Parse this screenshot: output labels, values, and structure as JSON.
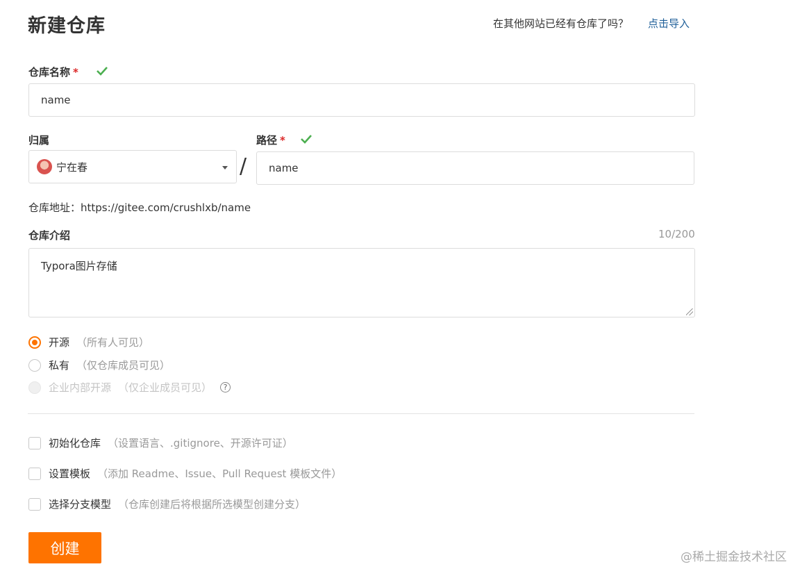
{
  "page_title": "新建仓库",
  "import": {
    "question": "在其他网站已经有仓库了吗？",
    "link": "点击导入"
  },
  "repo_name": {
    "label": "仓库名称",
    "required_mark": "*",
    "value": "name"
  },
  "owner": {
    "label": "归属",
    "selected": "宁在春"
  },
  "path_separator": "/",
  "path": {
    "label": "路径",
    "required_mark": "*",
    "value": "name"
  },
  "repo_address": "仓库地址：https://gitee.com/crushlxb/name",
  "description": {
    "label": "仓库介绍",
    "counter": "10/200",
    "value": "Typora图片存储"
  },
  "visibility": [
    {
      "label": "开源",
      "note": "（所有人可见）",
      "state": "selected"
    },
    {
      "label": "私有",
      "note": "（仅仓库成员可见）",
      "state": "unselected"
    },
    {
      "label": "企业内部开源",
      "note": "（仅企业成员可见）",
      "state": "disabled"
    }
  ],
  "help_glyph": "?",
  "options": [
    {
      "label": "初始化仓库",
      "note": "（设置语言、.gitignore、开源许可证）",
      "checked": false
    },
    {
      "label": "设置模板",
      "note": "（添加 Readme、Issue、Pull Request 模板文件）",
      "checked": false
    },
    {
      "label": "选择分支模型",
      "note": "（仓库创建后将根据所选模型创建分支）",
      "checked": false
    }
  ],
  "submit_label": "创建",
  "watermark": "@稀土掘金技术社区",
  "colors": {
    "accent": "#fe7300",
    "link": "#1f5f99",
    "required": "#db2828",
    "valid": "#4caf50"
  },
  "icons": {
    "valid": "check-icon",
    "dropdown": "caret-down-icon",
    "help": "help-circle-icon"
  }
}
